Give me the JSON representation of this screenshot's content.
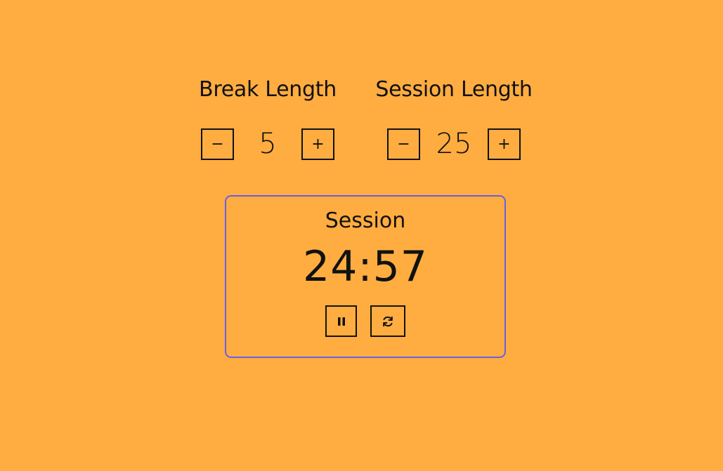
{
  "break": {
    "label": "Break Length",
    "value": "5",
    "decrement_label": "−",
    "increment_label": "+"
  },
  "session": {
    "label": "Session Length",
    "value": "25",
    "decrement_label": "−",
    "increment_label": "+"
  },
  "timer": {
    "label": "Session",
    "time_left": "24:57",
    "start_stop_icon": "pause-icon",
    "reset_icon": "refresh-icon"
  },
  "colors": {
    "background": "#FFAD40",
    "timer_border": "#6A5EE8",
    "text": "#111111"
  }
}
